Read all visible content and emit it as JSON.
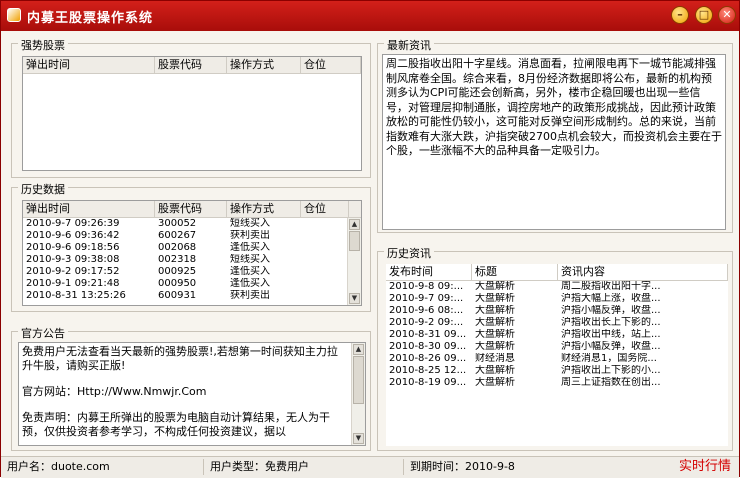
{
  "window": {
    "title": "内募王股票操作系统"
  },
  "strong": {
    "label": "强势股票",
    "columns": [
      "弹出时间",
      "股票代码",
      "操作方式",
      "仓位"
    ],
    "rows": []
  },
  "history": {
    "label": "历史数据",
    "columns": [
      "弹出时间",
      "股票代码",
      "操作方式",
      "仓位"
    ],
    "rows": [
      [
        "2010-9-7 09:26:39",
        "300052",
        "短线买入",
        ""
      ],
      [
        "2010-9-6 09:36:42",
        "600267",
        "获利卖出",
        ""
      ],
      [
        "2010-9-6 09:18:56",
        "002068",
        "逢低买入",
        ""
      ],
      [
        "2010-9-3 09:38:08",
        "002318",
        "短线买入",
        ""
      ],
      [
        "2010-9-2 09:17:52",
        "000925",
        "逢低买入",
        ""
      ],
      [
        "2010-9-1 09:21:48",
        "000950",
        "逢低买入",
        ""
      ],
      [
        "2010-8-31 13:25:26",
        "600931",
        "获利卖出",
        ""
      ]
    ]
  },
  "notice": {
    "label": "官方公告",
    "line1": "免费用户无法查看当天最新的强势股票!,若想第一时间获知主力拉升牛股，请购买正版!",
    "line2": "官方网站：Http://Www.Nmwjr.Com",
    "line3": "免责声明：内募王所弹出的股票为电脑自动计算结果，无人为干预，仅供投资者参考学习，不构成任何投资建议，据以"
  },
  "news": {
    "label": "最新资讯",
    "text": "周二股指收出阳十字星线。消息面看，拉闸限电再下一城节能减排强制风席卷全国。综合来看，8月份经济数据即将公布，最新的机构预测多认为CPI可能还会创新高，另外，楼市企稳回暖也出现一些信号，对管理层抑制通胀，调控房地产的政策形成挑战，因此预计政策放松的可能性仍较小，这可能对反弹空间形成制约。总的来说，当前指数难有大涨大跌，沪指突破2700点机会较大，而投资机会主要在于个股，一些涨幅不大的品种具备一定吸引力。"
  },
  "news_history": {
    "label": "历史资讯",
    "columns": [
      "发布时间",
      "标题",
      "资讯内容"
    ],
    "rows": [
      [
        "2010-9-8 09:...",
        "大盘解析",
        "周二股指收出阳十字..."
      ],
      [
        "2010-9-7 09:...",
        "大盘解析",
        "沪指大幅上涨，收盘..."
      ],
      [
        "2010-9-6 08:...",
        "大盘解析",
        "沪指小幅反弹，收盘..."
      ],
      [
        "2010-9-2 09:...",
        "大盘解析",
        "沪指收出长上下影的..."
      ],
      [
        "2010-8-31 09...",
        "大盘解析",
        "沪指收出中线，站上..."
      ],
      [
        "2010-8-30 09...",
        "大盘解析",
        "沪指小幅反弹，收盘..."
      ],
      [
        "2010-8-26 09...",
        "财经消息",
        "财经消息1，国务院..."
      ],
      [
        "2010-8-25 12...",
        "大盘解析",
        "沪指收出上下影的小..."
      ],
      [
        "2010-8-19 09...",
        "大盘解析",
        "周三上证指数在创出..."
      ]
    ]
  },
  "status": {
    "user": "用户名：duote.com",
    "type": "用户类型：免费用户",
    "expire": "到期时间：2010-9-8",
    "live": "实时行情"
  }
}
